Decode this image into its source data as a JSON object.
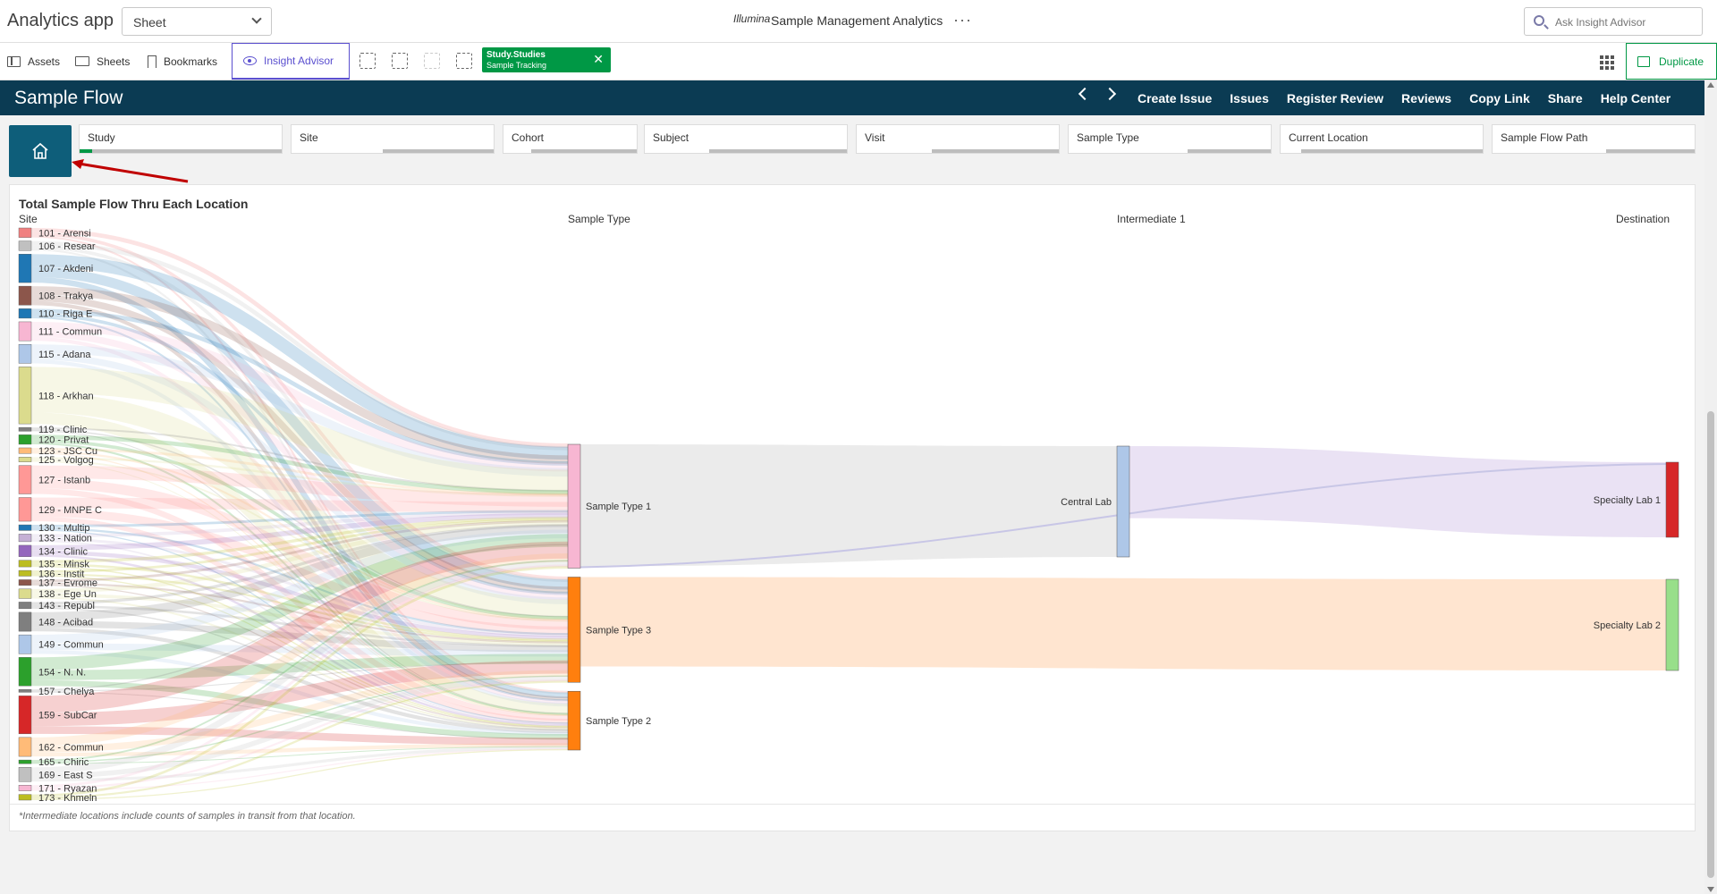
{
  "header": {
    "app_title": "Analytics app",
    "sheet_select": "Sheet",
    "logo_text": "Illumina",
    "center_title": "Sample Management Analytics",
    "more": "···",
    "search_placeholder": "Ask Insight Advisor"
  },
  "toolbar": {
    "assets": "Assets",
    "sheets": "Sheets",
    "bookmarks": "Bookmarks",
    "insight_advisor": "Insight Advisor",
    "duplicate": "Duplicate",
    "selection_chip": {
      "field": "Study.Studies",
      "value": "Sample Tracking"
    }
  },
  "navbar": {
    "title": "Sample Flow",
    "links": [
      "Create Issue",
      "Issues",
      "Register Review",
      "Reviews",
      "Copy Link",
      "Share",
      "Help Center"
    ]
  },
  "filters": [
    {
      "label": "Study",
      "selected_fraction": 0.06,
      "possible_fraction": 0.0
    },
    {
      "label": "Site",
      "selected_fraction": 0.0,
      "possible_fraction": 0.45
    },
    {
      "label": "Cohort",
      "selected_fraction": 0.0,
      "possible_fraction": 0.21
    },
    {
      "label": "Subject",
      "selected_fraction": 0.0,
      "possible_fraction": 0.32
    },
    {
      "label": "Visit",
      "selected_fraction": 0.0,
      "possible_fraction": 0.37
    },
    {
      "label": "Sample Type",
      "selected_fraction": 0.0,
      "possible_fraction": 0.59
    },
    {
      "label": "Current Location",
      "selected_fraction": 0.0,
      "possible_fraction": 0.1
    },
    {
      "label": "Sample Flow Path",
      "selected_fraction": 0.0,
      "possible_fraction": 0.56
    }
  ],
  "chart": {
    "title": "Total Sample Flow Thru Each Location",
    "footnote": "*Intermediate locations include counts of samples in transit from that location.",
    "chart_data": {
      "type": "sankey",
      "columns": [
        "Site",
        "Sample Type",
        "Intermediate 1",
        "Destination"
      ],
      "sites": [
        {
          "label": "101 - Arensi",
          "color": "#f08080",
          "weight": 1
        },
        {
          "label": "106 - Resear",
          "color": "#c0c0c0",
          "weight": 1
        },
        {
          "label": "107 - Akdeni",
          "color": "#1f77b4",
          "weight": 3
        },
        {
          "label": "108 - Trakya",
          "color": "#8c564b",
          "weight": 2
        },
        {
          "label": "110 - Riga E",
          "color": "#1f77b4",
          "weight": 1
        },
        {
          "label": "111 - Commun",
          "color": "#f7b6d2",
          "weight": 2
        },
        {
          "label": "115 - Adana",
          "color": "#aec7e8",
          "weight": 2
        },
        {
          "label": "118 - Arkhan",
          "color": "#dbdb8d",
          "weight": 6
        },
        {
          "label": "119 - Clinic",
          "color": "#7f7f7f",
          "weight": 0.4
        },
        {
          "label": "120 - Privat",
          "color": "#2ca02c",
          "weight": 1
        },
        {
          "label": "123 - JSC Cu",
          "color": "#ffbb78",
          "weight": 0.6
        },
        {
          "label": "125 - Volgog",
          "color": "#dbdb8d",
          "weight": 0.5
        },
        {
          "label": "127 - Istanb",
          "color": "#ff9896",
          "weight": 3
        },
        {
          "label": "129 - MNPE C",
          "color": "#ff9896",
          "weight": 2.5
        },
        {
          "label": "130 - Multip",
          "color": "#1f77b4",
          "weight": 0.6
        },
        {
          "label": "133 - Nation",
          "color": "#c5b0d5",
          "weight": 0.8
        },
        {
          "label": "134 - Clinic",
          "color": "#9467bd",
          "weight": 1.2
        },
        {
          "label": "135 - Minsk",
          "color": "#bcbd22",
          "weight": 0.7
        },
        {
          "label": "136 - Instit",
          "color": "#bcbd22",
          "weight": 0.6
        },
        {
          "label": "137 - Evrome",
          "color": "#8c564b",
          "weight": 0.6
        },
        {
          "label": "138 - Ege Un",
          "color": "#dbdb8d",
          "weight": 1
        },
        {
          "label": "143 - Republ",
          "color": "#7f7f7f",
          "weight": 0.7
        },
        {
          "label": "148 - Acibad",
          "color": "#7f7f7f",
          "weight": 2
        },
        {
          "label": "149 - Commun",
          "color": "#aec7e8",
          "weight": 2
        },
        {
          "label": "154 - N. N.",
          "color": "#2ca02c",
          "weight": 3
        },
        {
          "label": "157 - Chelya",
          "color": "#7f7f7f",
          "weight": 0.3
        },
        {
          "label": "159 - SubCar",
          "color": "#d62728",
          "weight": 4
        },
        {
          "label": "162 - Commun",
          "color": "#ffbb78",
          "weight": 2
        },
        {
          "label": "165 - Chiric",
          "color": "#2ca02c",
          "weight": 0.4
        },
        {
          "label": "169 - East S",
          "color": "#c0c0c0",
          "weight": 1.5
        },
        {
          "label": "171 - Ryazan",
          "color": "#f7b6d2",
          "weight": 0.6
        },
        {
          "label": "173 - Khmeln",
          "color": "#bcbd22",
          "weight": 0.6
        }
      ],
      "sample_types": [
        {
          "label": "Sample Type 1",
          "color": "#f7b6d2",
          "weight": 40
        },
        {
          "label": "Sample Type 3",
          "color": "#ff7f0e",
          "weight": 34
        },
        {
          "label": "Sample Type 2",
          "color": "#ff7f0e",
          "weight": 19
        }
      ],
      "intermediates": [
        {
          "label": "Central Lab",
          "color": "#aec7e8",
          "weight": 36
        }
      ],
      "destinations": [
        {
          "label": "Specialty Lab 1",
          "color": "#d62728",
          "weight": 25
        },
        {
          "label": "Specialty Lab 2",
          "color": "#98df8a",
          "weight": 30
        }
      ],
      "links": [
        {
          "from": "Sample Type 1",
          "to": "Central Lab",
          "value": 36,
          "color": "#e8e8e8"
        },
        {
          "from": "Sample Type 1",
          "to": "Specialty Lab 1",
          "value": 1,
          "color": "#d6d6ee"
        },
        {
          "from": "Sample Type 3",
          "to": "Specialty Lab 2",
          "value": 30,
          "color": "#ffe0c8"
        },
        {
          "from": "Central Lab",
          "to": "Specialty Lab 1",
          "value": 24,
          "color": "#e6ddf2"
        }
      ]
    }
  }
}
